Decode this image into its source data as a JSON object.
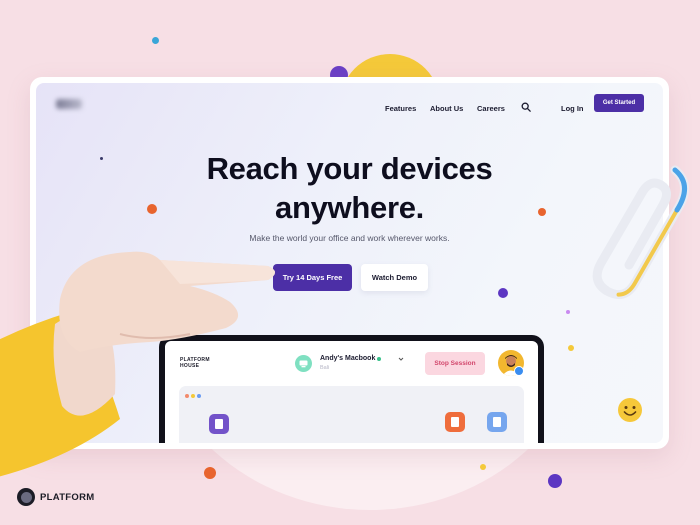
{
  "nav": {
    "features": "Features",
    "about": "About Us",
    "careers": "Careers",
    "login": "Log In",
    "get_started": "Get Started"
  },
  "hero": {
    "title_line1": "Reach your devices",
    "title_line2": "anywhere.",
    "subtitle": "Make the world your office and work wherever works.",
    "cta_primary": "Try 14 Days Free",
    "cta_secondary": "Watch Demo"
  },
  "app_preview": {
    "brand_line1": "PLATFORM",
    "brand_line2": "HOUSE",
    "device_name": "Andy's Macbook",
    "device_location": "Bali",
    "stop_session": "Stop Session"
  },
  "footer": {
    "brand": "PLATFORM"
  },
  "colors": {
    "primary": "#4c2fa6",
    "background": "#f7dfe5",
    "stop_session_bg": "#fbd7e0",
    "stop_session_text": "#d2466b",
    "accent_yellow": "#f4c93a",
    "accent_orange": "#e8642e"
  },
  "icons": [
    "search-icon",
    "chevron-down-icon",
    "cursor-icon",
    "document-icon",
    "image-icon",
    "paperclip-icon",
    "smiley-icon"
  ]
}
